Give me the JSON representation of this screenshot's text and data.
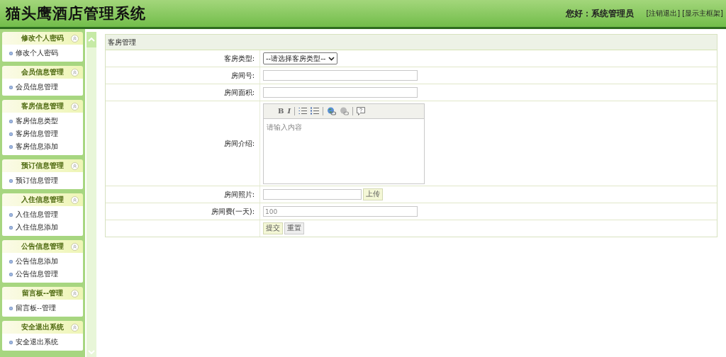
{
  "header": {
    "title": "猫头鹰酒店管理系统",
    "greeting": "您好：系统管理员",
    "links": [
      "[注销退出]",
      "[显示主框架]"
    ]
  },
  "sidebar": {
    "groups": [
      {
        "title": "修改个人密码",
        "items": [
          "修改个人密码"
        ]
      },
      {
        "title": "会员信息管理",
        "items": [
          "会员信息管理"
        ]
      },
      {
        "title": "客房信息管理",
        "items": [
          "客房信息类型",
          "客房信息管理",
          "客房信息添加"
        ]
      },
      {
        "title": "预订信息管理",
        "items": [
          "预订信息管理"
        ]
      },
      {
        "title": "入住信息管理",
        "items": [
          "入住信息管理",
          "入住信息添加"
        ]
      },
      {
        "title": "公告信息管理",
        "items": [
          "公告信息添加",
          "公告信息管理"
        ]
      },
      {
        "title": "留言板--管理",
        "items": [
          "留言板--管理"
        ]
      },
      {
        "title": "安全退出系统",
        "items": [
          "安全退出系统"
        ]
      }
    ]
  },
  "form": {
    "title": "客房管理",
    "rows": [
      {
        "kind": "select",
        "label": "客房类型:",
        "value": "--请选择客房类型--"
      },
      {
        "kind": "input",
        "label": "房间号:"
      },
      {
        "kind": "input",
        "label": "房间面积:"
      },
      {
        "kind": "editor",
        "label": "房间介绍:",
        "placeholder": "请输入内容",
        "toolbar": [
          {
            "kind": "bold",
            "label": "B"
          },
          {
            "kind": "italic",
            "label": "I"
          },
          {
            "kind": "sep"
          },
          {
            "kind": "ordered-list"
          },
          {
            "kind": "bullet-list"
          },
          {
            "kind": "sep"
          },
          {
            "kind": "link"
          },
          {
            "kind": "unlink"
          },
          {
            "kind": "sep"
          },
          {
            "kind": "help"
          }
        ]
      },
      {
        "kind": "upload",
        "label": "房间照片:",
        "button": "上传"
      },
      {
        "kind": "input",
        "label": "房间费(一天):",
        "placeholder": "100"
      },
      {
        "kind": "buttons",
        "buttons": [
          "提交",
          "重置"
        ]
      }
    ]
  }
}
